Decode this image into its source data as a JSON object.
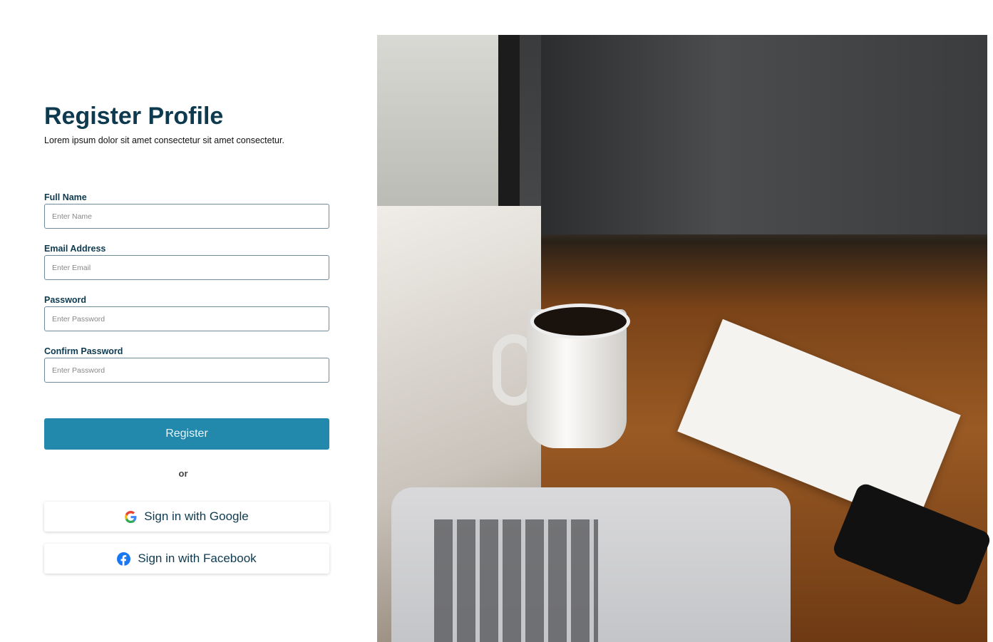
{
  "header": {
    "title": "Register Profile",
    "subtitle": "Lorem ipsum dolor sit amet consectetur sit amet consectetur."
  },
  "form": {
    "full_name": {
      "label": "Full Name",
      "placeholder": "Enter Name",
      "value": ""
    },
    "email": {
      "label": "Email Address",
      "placeholder": "Enter Email",
      "value": ""
    },
    "password": {
      "label": "Password",
      "placeholder": "Enter Password",
      "value": ""
    },
    "confirm_password": {
      "label": "Confirm Password",
      "placeholder": "Enter Password",
      "value": ""
    }
  },
  "actions": {
    "register_label": "Register",
    "or_label": "or",
    "google_label": "Sign in with Google",
    "facebook_label": "Sign in with Facebook"
  },
  "colors": {
    "primary": "#2289ad",
    "heading": "#0e3a4f",
    "facebook": "#1877f2"
  }
}
